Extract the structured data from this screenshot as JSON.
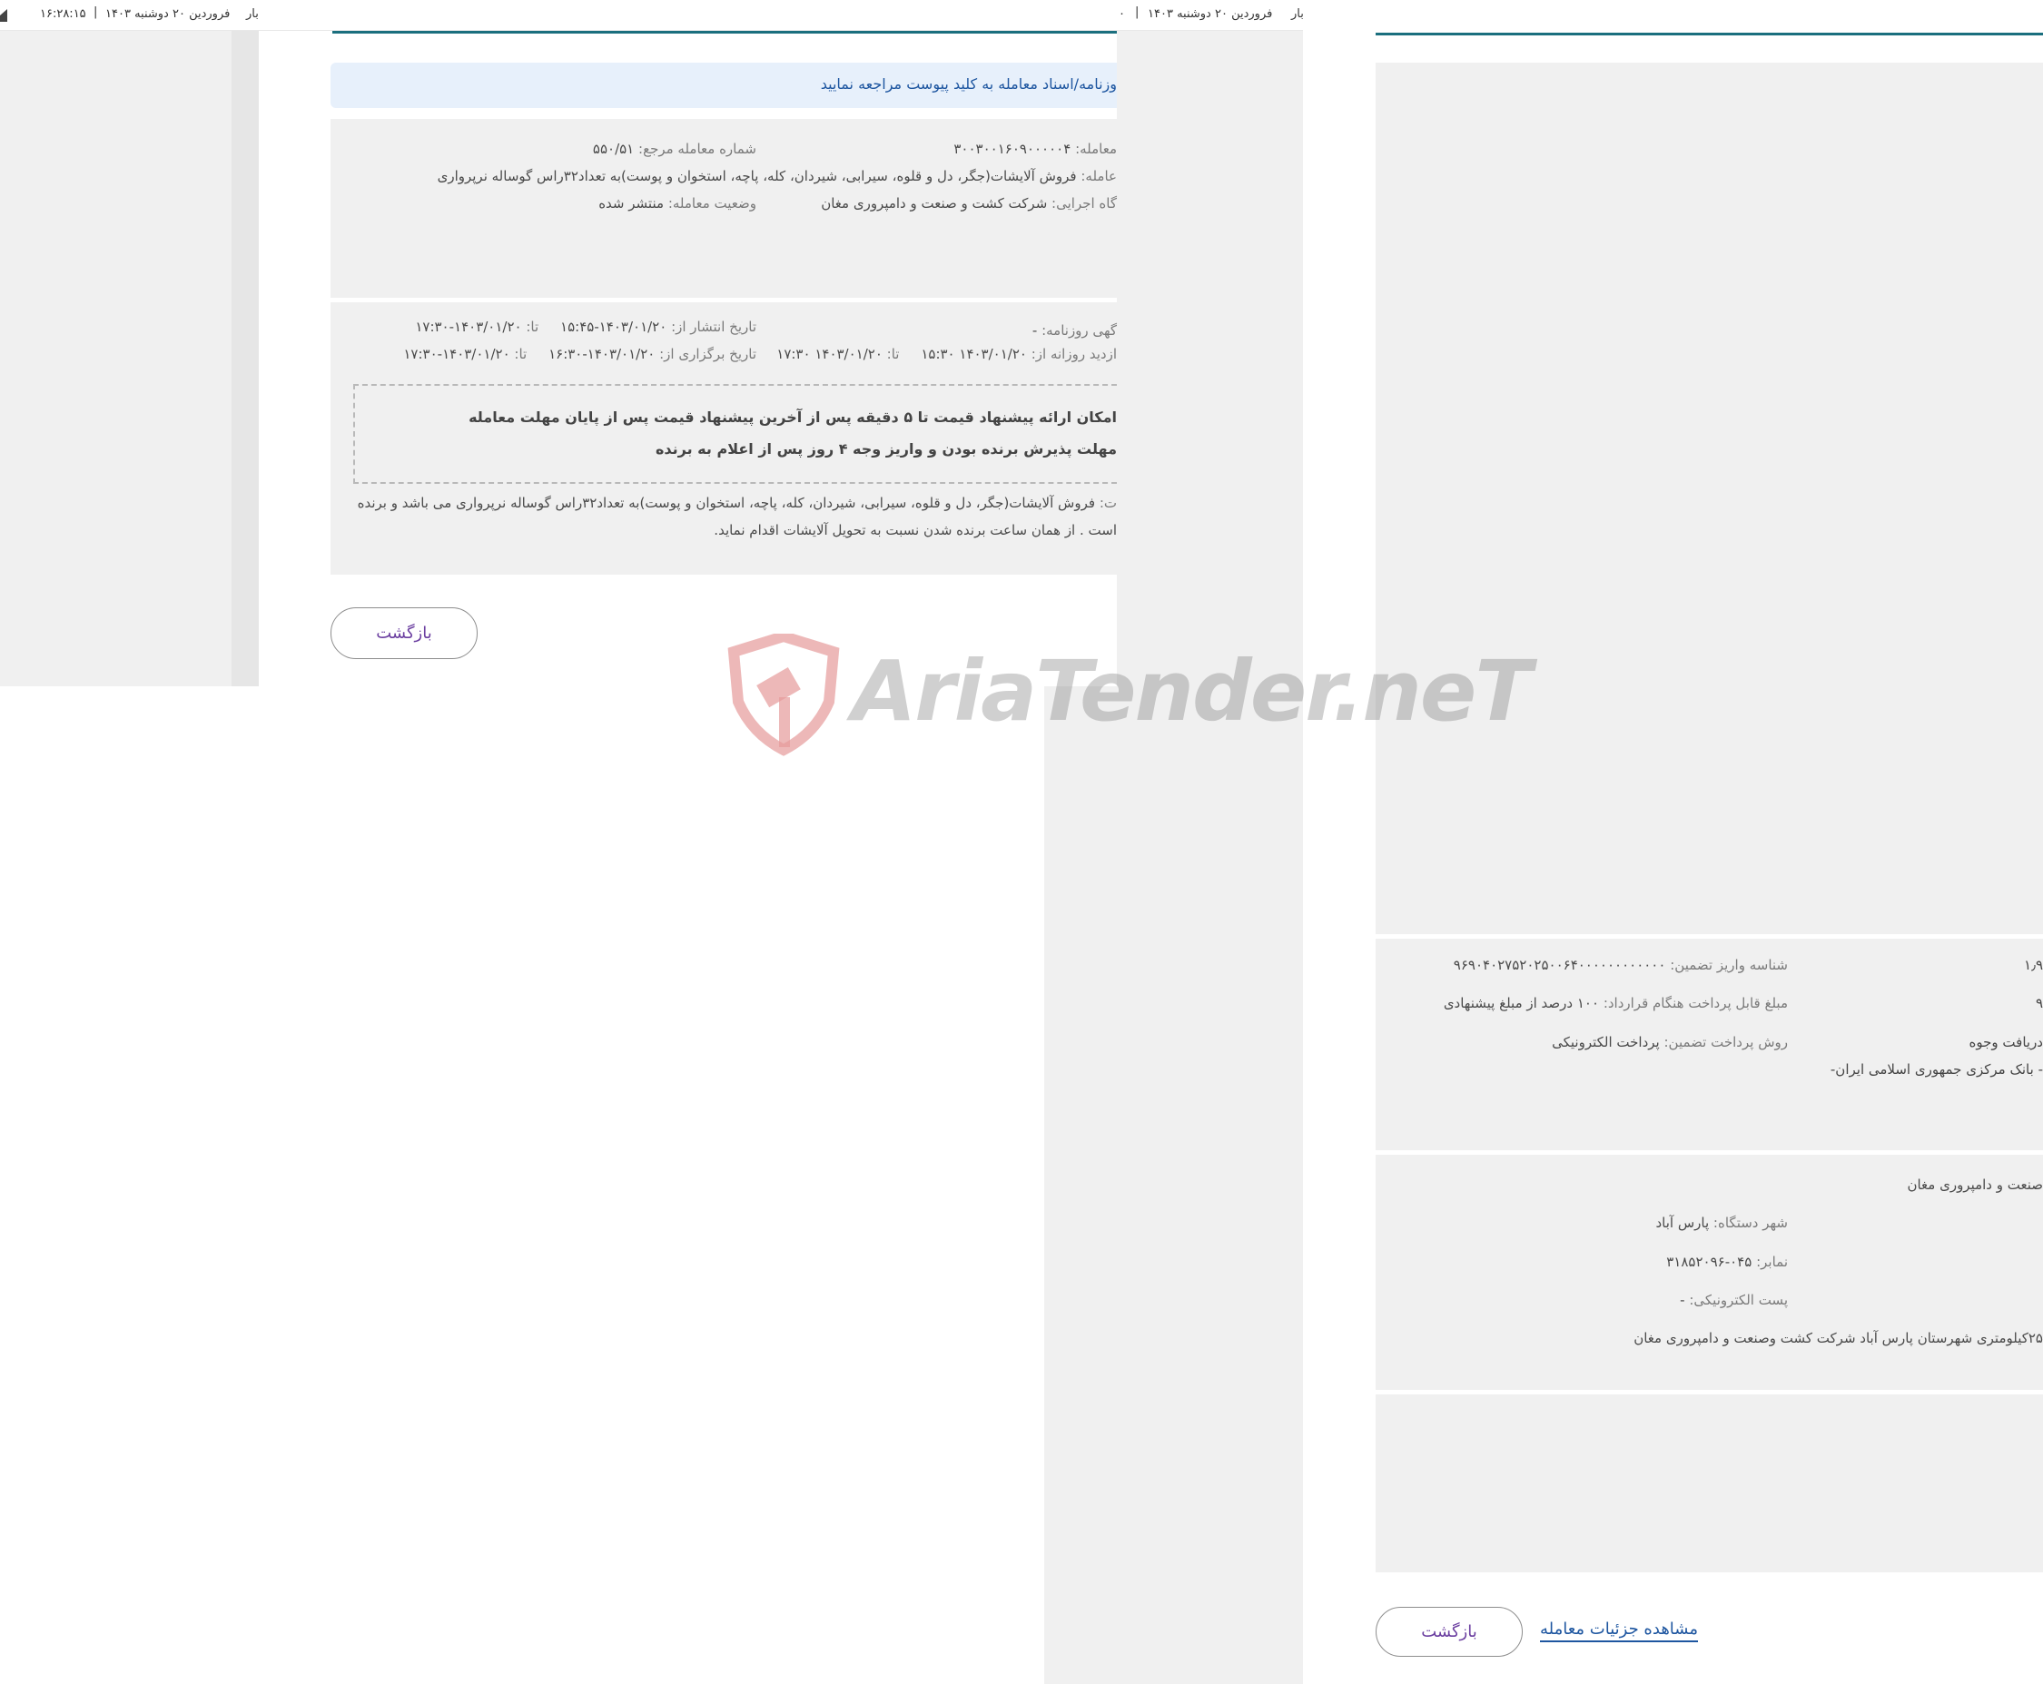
{
  "left_topbar": {
    "time": "۱۶:۲۸:۱۵",
    "date": "فروردین ۲۰ دوشنبه ۱۴۰۳",
    "fragment": "بار"
  },
  "right_topbar": {
    "zero": "۰",
    "date": "فروردین ۲۰ دوشنبه ۱۴۰۳",
    "fragment": "بار"
  },
  "left_notice": "وزنامه/اسناد معامله به کلید پیوست مراجعه نمایید",
  "left_panel1": {
    "deal_no_label": "معامله:",
    "deal_no_value": "۳۰۰۳۰۰۱۶۰۹۰۰۰۰۰۴",
    "ref_no_label": "شماره معامله مرجع:",
    "ref_no_value": "۵۵۰/۵۱",
    "subject_label": "عامله:",
    "subject_value": "فروش آلایشات(جگر، دل و قلوه، سیرابی، شیردان، کله، پاچه، استخوان و پوست)به تعداد۳۲راس گوساله نرپرواری",
    "executor_label": "گاه اجرایی:",
    "executor_value": "شرکت کشت و صنعت و دامپروری مغان",
    "status_label": "وضعیت معامله:",
    "status_value": "منتشر شده"
  },
  "left_panel2": {
    "newspaper_label": "گهی روزنامه:",
    "newspaper_value": "-",
    "publish_from_label": "تاریخ انتشار از:",
    "publish_from_value": "۱۴۰۳/۰۱/۲۰-۱۵:۴۵",
    "publish_to_label": "تا:",
    "publish_to_value": "۱۴۰۳/۰۱/۲۰-۱۷:۳۰",
    "visit_from_label": "ازدید روزانه از:",
    "visit_from_value": "۱۴۰۳/۰۱/۲۰ ۱۵:۳۰",
    "visit_to_label": "تا:",
    "visit_to_value": "۱۴۰۳/۰۱/۲۰ ۱۷:۳۰",
    "hold_from_label": "تاریخ برگزاری از:",
    "hold_from_value": "۱۴۰۳/۰۱/۲۰-۱۶:۳۰",
    "hold_to_label": "تا:",
    "hold_to_value": "۱۴۰۳/۰۱/۲۰-۱۷:۳۰",
    "rule1": "امکان ارائه پیشنهاد قیمت تا ۵ دقیقه پس از آخرین پیشنهاد قیمت پس از پایان مهلت معامله",
    "rule2": "مهلت پذیرش برنده بودن و واریز وجه ۴ روز پس از اعلام به برنده",
    "desc_label": "ت:",
    "desc_line1": "فروش آلایشات(جگر، دل و قلوه، سیرابی، شیردان، کله، پاچه، استخوان و پوست)به تعداد۳۲راس گوساله نرپرواری می باشد و برنده",
    "desc_line2": "است . از همان ساعت برنده شدن نسبت به تحویل آلایشات اقدام نماید."
  },
  "left_back_button": "بازگشت",
  "right_payment": {
    "guarantee_id_label": "شناسه واریز تضمین:",
    "guarantee_id_value": "۹۶۹۰۴۰۲۷۵۲۰۲۵۰۰۶۴۰۰۰۰۰۰۰۰۰۰۰۰",
    "contract_amount_label": "مبلغ قابل پرداخت هنگام قرارداد:",
    "contract_amount_value": "۱۰۰ درصد از مبلغ پیشنهادی",
    "payment_method_label": "روش پرداخت تضمین:",
    "payment_method_value": "پرداخت الکترونیکی",
    "cut_value1": "۱٫۹",
    "cut_value2": "۹",
    "cut_receive": "دریافت وجوه",
    "cut_bank": "- بانک مرکزی جمهوری اسلامی ایران-"
  },
  "right_org": {
    "org_name_cut": "صنعت و دامپروری مغان",
    "city_label": "شهر دستگاه:",
    "city_value": "پارس آباد",
    "fax_label": "نمابر:",
    "fax_value": "۰۴۵-۳۱۸۵۲۰۹۶",
    "email_label": "پست الکترونیکی:",
    "email_value": "-",
    "address_cut": "۲۵کیلومتری شهرستان پارس آباد شرکت کشت وصنعت و دامپروری مغان"
  },
  "right_back_button": "بازگشت",
  "right_details_link": "مشاهده جزئیات معامله",
  "watermark_text": "AriaTender.neT",
  "colors": {
    "teal": "#1b6f7e",
    "link_blue": "#1e56a0",
    "purple": "#6b3fa0",
    "panel_gray": "#f0f0f0",
    "watermark_red": "#e59a9a"
  }
}
